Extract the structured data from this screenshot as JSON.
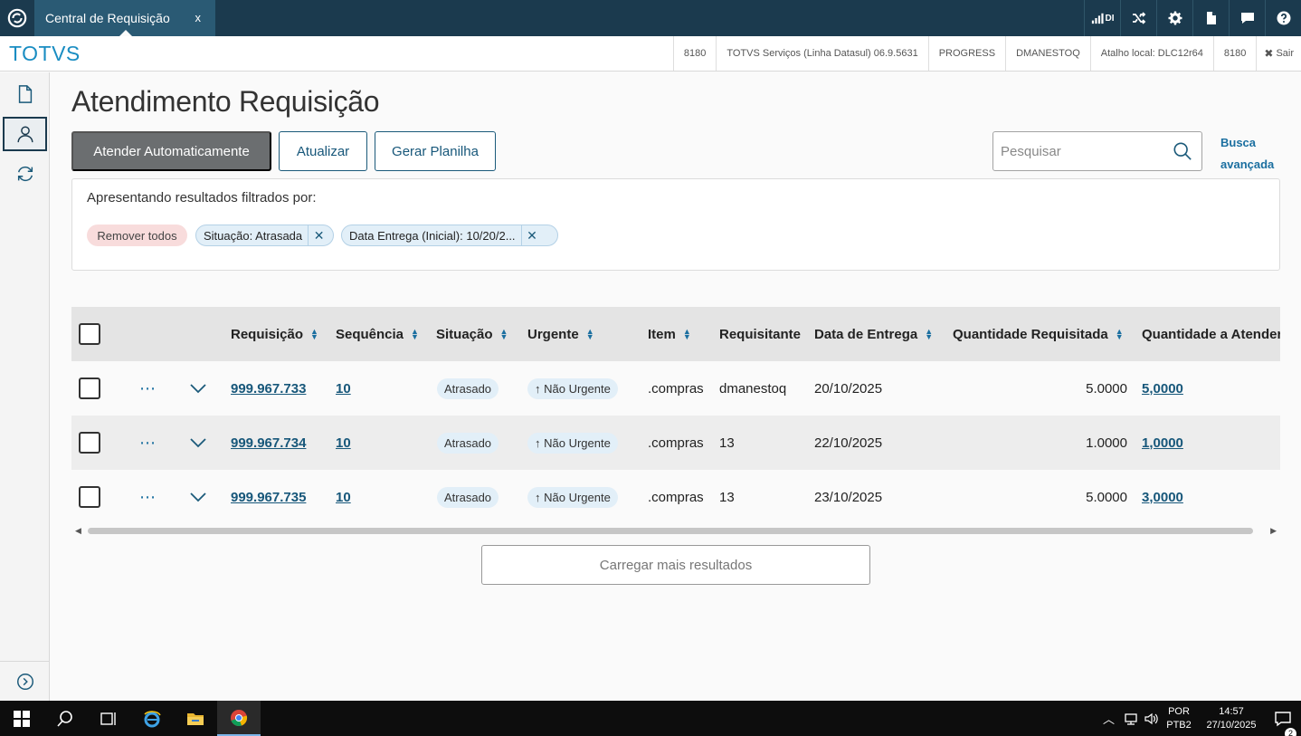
{
  "topbar": {
    "tab_title": "Central de Requisição",
    "tab_close": "x",
    "signal_label": "DI"
  },
  "infobar": {
    "brand": "TOTVS",
    "cells": [
      "8180",
      "TOTVS Serviços (Linha Datasul) 06.9.5631",
      "PROGRESS",
      "DMANESTOQ",
      "Atalho local: DLC12r64",
      "8180"
    ],
    "logout": "Sair"
  },
  "page": {
    "title": "Atendimento Requisição",
    "btn_auto": "Atender Automaticamente",
    "btn_refresh": "Atualizar",
    "btn_sheet": "Gerar Planilha",
    "search_placeholder": "Pesquisar",
    "advanced_search": "Busca avançada"
  },
  "filters": {
    "title": "Apresentando resultados filtrados por:",
    "remove_all": "Remover todos",
    "chips": [
      "Situação: Atrasada",
      "Data Entrega (Inicial): 10/20/2..."
    ]
  },
  "table": {
    "columns": [
      "Requisição",
      "Sequência",
      "Situação",
      "Urgente",
      "Item",
      "Requisitante",
      "Data de Entrega",
      "Quantidade Requisitada",
      "Quantidade a Atender"
    ],
    "rows": [
      {
        "req": "999.967.733",
        "seq": "10",
        "status": "Atrasado",
        "urgent": "Não Urgente",
        "item": ".compras",
        "requester": "dmanestoq",
        "date": "20/10/2025",
        "qty_req": "5.0000",
        "qty_att": "5,0000"
      },
      {
        "req": "999.967.734",
        "seq": "10",
        "status": "Atrasado",
        "urgent": "Não Urgente",
        "item": ".compras",
        "requester": "13",
        "date": "22/10/2025",
        "qty_req": "1.0000",
        "qty_att": "1,0000"
      },
      {
        "req": "999.967.735",
        "seq": "10",
        "status": "Atrasado",
        "urgent": "Não Urgente",
        "item": ".compras",
        "requester": "13",
        "date": "23/10/2025",
        "qty_req": "5.0000",
        "qty_att": "3,0000"
      }
    ],
    "load_more": "Carregar mais resultados"
  },
  "taskbar": {
    "lang_top": "POR",
    "lang_bottom": "PTB2",
    "time": "14:57",
    "date": "27/10/2025",
    "notif_count": "2"
  },
  "colors": {
    "topbar": "#1b3a4e",
    "brand": "#1a8dc2",
    "link": "#17577a"
  }
}
